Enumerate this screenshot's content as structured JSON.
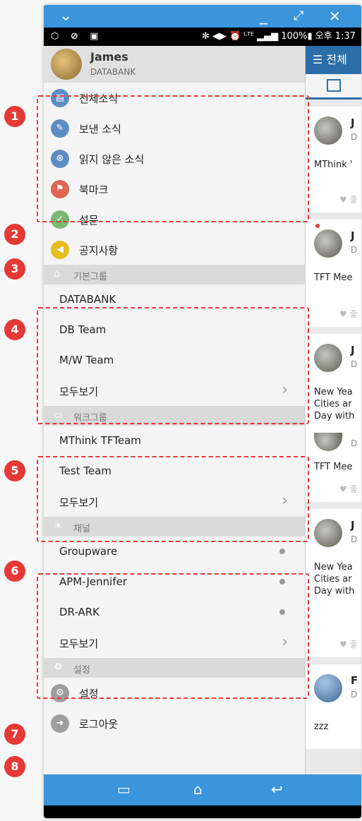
{
  "window": {
    "collapse_icon": "chevron-down-icon",
    "minimize": "_",
    "maximize": "⤢",
    "close": "✕"
  },
  "status_bar": {
    "left_icons": "⬡ ⊘ ▣",
    "right": "✻ ◀▶ ⏰ ᴸᵀᴱ ▂▄▆ 100%▮ 오후 1:37"
  },
  "profile": {
    "name": "James",
    "org": "DATABANK"
  },
  "menu": {
    "news_all": "전체소식",
    "news_sent": "보낸 소식",
    "news_unread": "읽지 않은 소식",
    "bookmark": "북마크",
    "survey": "설문",
    "notice": "공지사항"
  },
  "sections": {
    "basic_groups": "기본그룹",
    "work_groups": "워크그룹",
    "channels": "채널",
    "settings": "설정"
  },
  "basic_groups": [
    "DATABANK",
    "DB Team",
    "M/W Team"
  ],
  "work_groups": [
    "MThink TFTeam",
    "Test Team"
  ],
  "channels": [
    "Groupware",
    "APM-Jennifer",
    "DR-ARK"
  ],
  "see_all": "모두보기",
  "settings_item": "설정",
  "logout_item": "로그아웃",
  "feed": {
    "header": "☰ 전체",
    "cards": [
      {
        "name": "J",
        "sub": "D",
        "text": "MThink '",
        "like": "♥ 좋"
      },
      {
        "name": "J",
        "sub": "D",
        "text": "TFT Mee",
        "like": "♥ 좋"
      },
      {
        "name": "J",
        "sub": "D",
        "text1": "New Yea",
        "text2": "Cities ar",
        "text3": "Day with",
        "like": ""
      },
      {
        "name": "",
        "sub": "D",
        "text": "TFT Mee",
        "like": "♥ 좋"
      },
      {
        "name": "J",
        "sub": "D",
        "text1": "New Yea",
        "text2": "Cities ar",
        "text3": "Day with",
        "like": "♥ 좋"
      },
      {
        "name": "F",
        "sub": "D",
        "text": "zzz",
        "like": ""
      }
    ]
  },
  "nav_bar": {
    "recent": "▭",
    "home": "⌂",
    "back": "↩"
  },
  "badges": [
    "1",
    "2",
    "3",
    "4",
    "5",
    "6",
    "7",
    "8"
  ],
  "colors": {
    "accent": "#3a95dc",
    "annotation": "#e53935"
  }
}
